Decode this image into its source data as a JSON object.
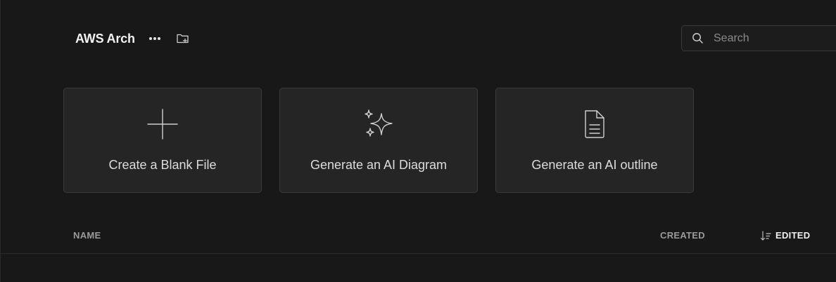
{
  "header": {
    "project_title": "AWS Arch",
    "more_icon": "more-horizontal-icon",
    "new_folder_icon": "folder-plus-icon"
  },
  "search": {
    "placeholder": "Search",
    "value": "",
    "icon": "search-icon"
  },
  "cards": [
    {
      "label": "Create a Blank File",
      "icon": "plus-icon"
    },
    {
      "label": "Generate an AI Diagram",
      "icon": "sparkles-icon"
    },
    {
      "label": "Generate an AI outline",
      "icon": "document-icon"
    }
  ],
  "table": {
    "columns": {
      "name": "NAME",
      "created": "CREATED",
      "edited": "EDITED"
    },
    "sort_icon": "sort-descending-icon"
  },
  "colors": {
    "background": "#181818",
    "card_background": "#252525",
    "border": "#3a3a3a",
    "text_primary": "#f2f2f2",
    "text_muted": "#9a9a9a"
  }
}
